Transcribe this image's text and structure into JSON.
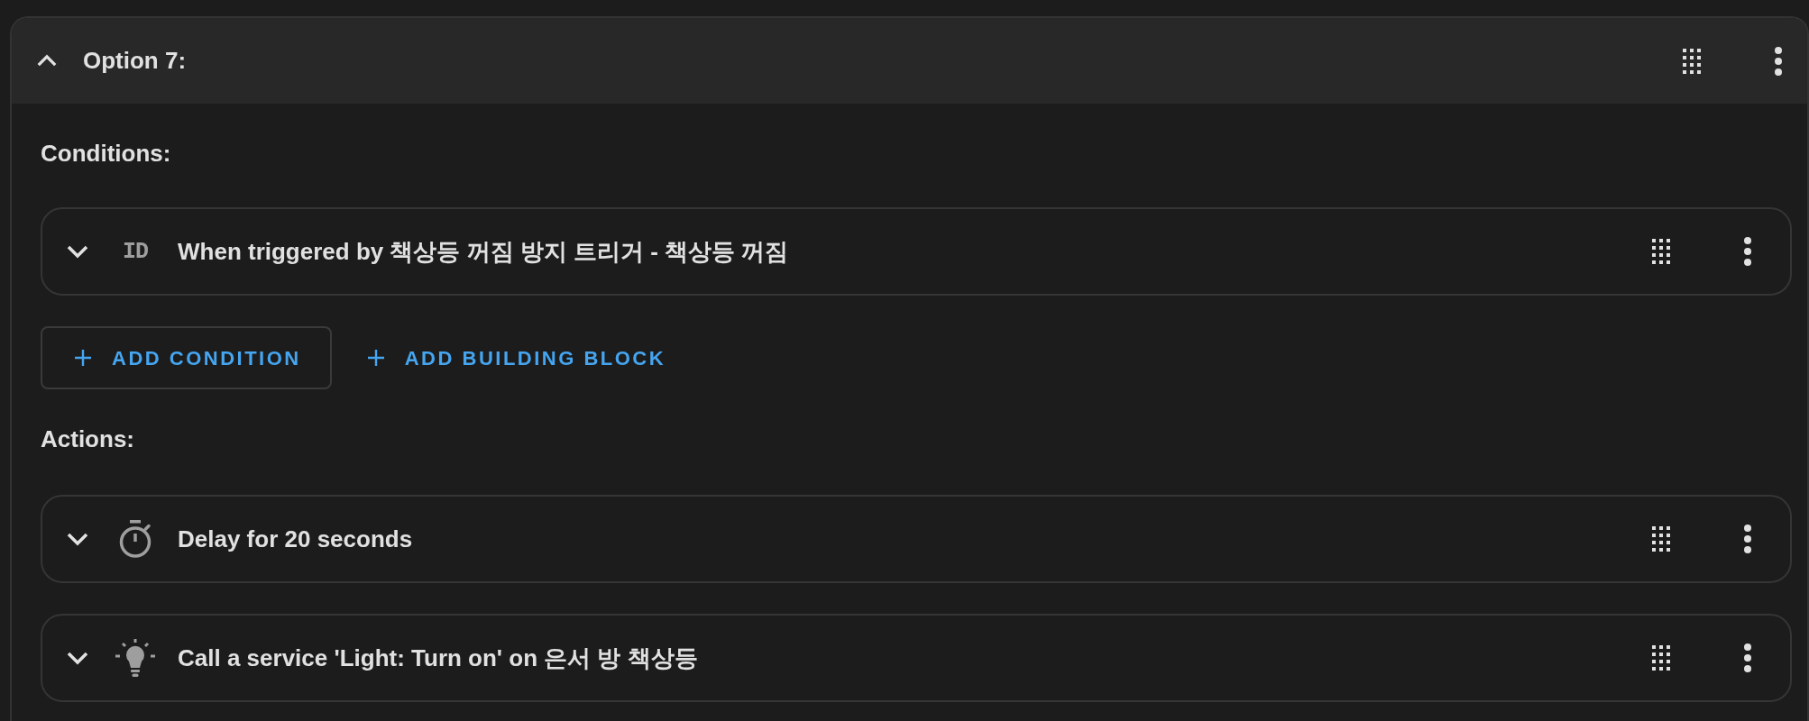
{
  "option": {
    "title": "Option 7:",
    "expanded": true
  },
  "conditions": {
    "label": "Conditions:",
    "items": [
      {
        "kind": "trigger",
        "icon_text": "ID",
        "text": "When triggered by 책상등 꺼짐 방지 트리거 - 책상등 꺼짐",
        "expanded": false
      }
    ]
  },
  "condition_buttons": [
    {
      "kind": "outlined",
      "label": "ADD CONDITION"
    },
    {
      "kind": "text",
      "label": "ADD BUILDING BLOCK"
    }
  ],
  "actions": {
    "label": "Actions:",
    "items": [
      {
        "kind": "delay",
        "text": "Delay for 20 seconds",
        "expanded": false
      },
      {
        "kind": "service",
        "text": "Call a service 'Light: Turn on' on 은서 방 책상등",
        "expanded": false
      }
    ]
  }
}
